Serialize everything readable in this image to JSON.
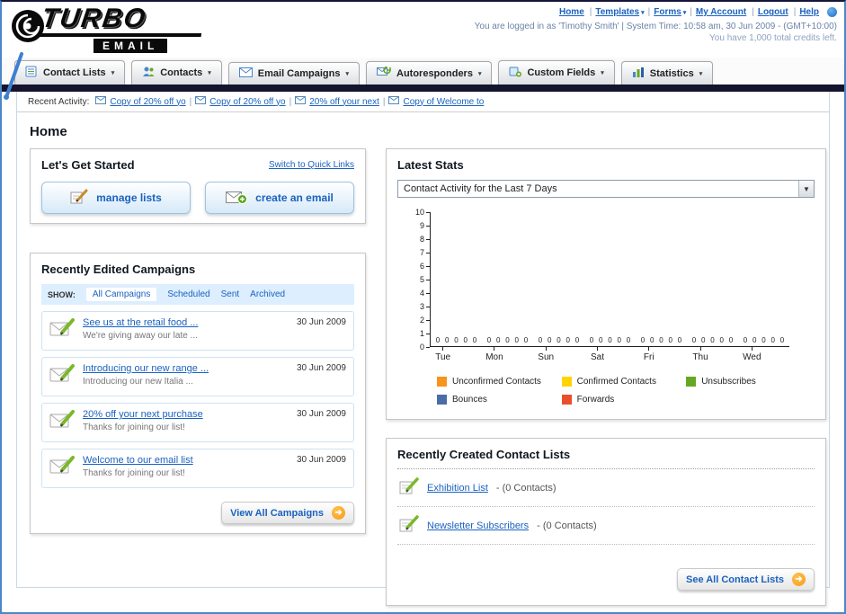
{
  "header": {
    "logo_line1": "TURBO",
    "logo_line2": "EMAIL",
    "nav": [
      {
        "label": "Home",
        "caret": "",
        "sep": "|"
      },
      {
        "label": "Templates",
        "caret": "▾",
        "sep": "|"
      },
      {
        "label": "Forms",
        "caret": "▾",
        "sep": "|"
      },
      {
        "label": "My Account",
        "caret": "",
        "sep": "|"
      },
      {
        "label": "Logout",
        "caret": "",
        "sep": "|"
      },
      {
        "label": "Help",
        "caret": "",
        "sep": ""
      }
    ],
    "login_info": "You are logged in as 'Timothy Smith' | System Time: 10:58 am, 30 Jun 2009 - (GMT+10:00)",
    "credits": "You have 1,000 total credits left."
  },
  "tabs": [
    {
      "label": "Contact Lists",
      "caret": "▾"
    },
    {
      "label": "Contacts",
      "caret": "▾"
    },
    {
      "label": "Email Campaigns",
      "caret": "▾"
    },
    {
      "label": "Autoresponders",
      "caret": "▾"
    },
    {
      "label": "Custom Fields",
      "caret": "▾"
    },
    {
      "label": "Statistics",
      "caret": "▾"
    }
  ],
  "recent_activity": {
    "label": "Recent Activity:",
    "items": [
      {
        "label": "Copy of 20% off yo",
        "sep": "|"
      },
      {
        "label": "Copy of 20% off yo",
        "sep": "|"
      },
      {
        "label": "20% off your next",
        "sep": "|"
      },
      {
        "label": "Copy of Welcome to",
        "sep": ""
      }
    ]
  },
  "page_title": "Home",
  "get_started": {
    "title": "Let's Get Started",
    "switch_link": "Switch to Quick Links",
    "manage_lists_label": "manage lists",
    "create_email_label": "create an email"
  },
  "campaigns": {
    "title": "Recently Edited Campaigns",
    "show_label": "SHOW:",
    "filters": [
      {
        "label": "All Campaigns"
      },
      {
        "label": "Scheduled"
      },
      {
        "label": "Sent"
      },
      {
        "label": "Archived"
      }
    ],
    "items": [
      {
        "title": "See us at the retail food ...",
        "subtitle": "We're giving away our late ...",
        "date": "30 Jun 2009"
      },
      {
        "title": "Introducing our new range ...",
        "subtitle": "Introducing our new Italia ...",
        "date": "30 Jun 2009"
      },
      {
        "title": "20% off your next purchase",
        "subtitle": "Thanks for joining our list!",
        "date": "30 Jun 2009"
      },
      {
        "title": "Welcome to our email list",
        "subtitle": "Thanks for joining our list!",
        "date": "30 Jun 2009"
      }
    ],
    "view_all_label": "View All Campaigns",
    "arrow": "➜"
  },
  "stats": {
    "title": "Latest Stats",
    "dropdown_value": "Contact Activity for the Last 7 Days",
    "dropdown_arrow": "▼",
    "chart_data": {
      "type": "bar",
      "title": "Contact Activity for the Last 7 Days",
      "categories": [
        "Tue",
        "Mon",
        "Sun",
        "Sat",
        "Fri",
        "Thu",
        "Wed"
      ],
      "series": [
        {
          "name": "Unconfirmed Contacts",
          "color": "#f7941d",
          "values": [
            0,
            0,
            0,
            0,
            0,
            0,
            0
          ]
        },
        {
          "name": "Confirmed Contacts",
          "color": "#ffd400",
          "values": [
            0,
            0,
            0,
            0,
            0,
            0,
            0
          ]
        },
        {
          "name": "Unsubscribes",
          "color": "#66a822",
          "values": [
            0,
            0,
            0,
            0,
            0,
            0,
            0
          ]
        },
        {
          "name": "Bounces",
          "color": "#4a6da8",
          "values": [
            0,
            0,
            0,
            0,
            0,
            0,
            0
          ]
        },
        {
          "name": "Forwards",
          "color": "#e8502d",
          "values": [
            0,
            0,
            0,
            0,
            0,
            0,
            0
          ]
        }
      ],
      "ylim": [
        0,
        10
      ],
      "y_ticks": [
        10,
        9,
        8,
        7,
        6,
        5,
        4,
        3,
        2,
        1,
        0
      ],
      "grid": false,
      "legend_position": "bottom"
    }
  },
  "contact_lists": {
    "title": "Recently Created Contact Lists",
    "items": [
      {
        "name": "Exhibition List",
        "detail": "- (0 Contacts)"
      },
      {
        "name": "Newsletter Subscribers",
        "detail": "- (0 Contacts)"
      }
    ],
    "see_all_label": "See All Contact Lists",
    "arrow": "➜"
  }
}
